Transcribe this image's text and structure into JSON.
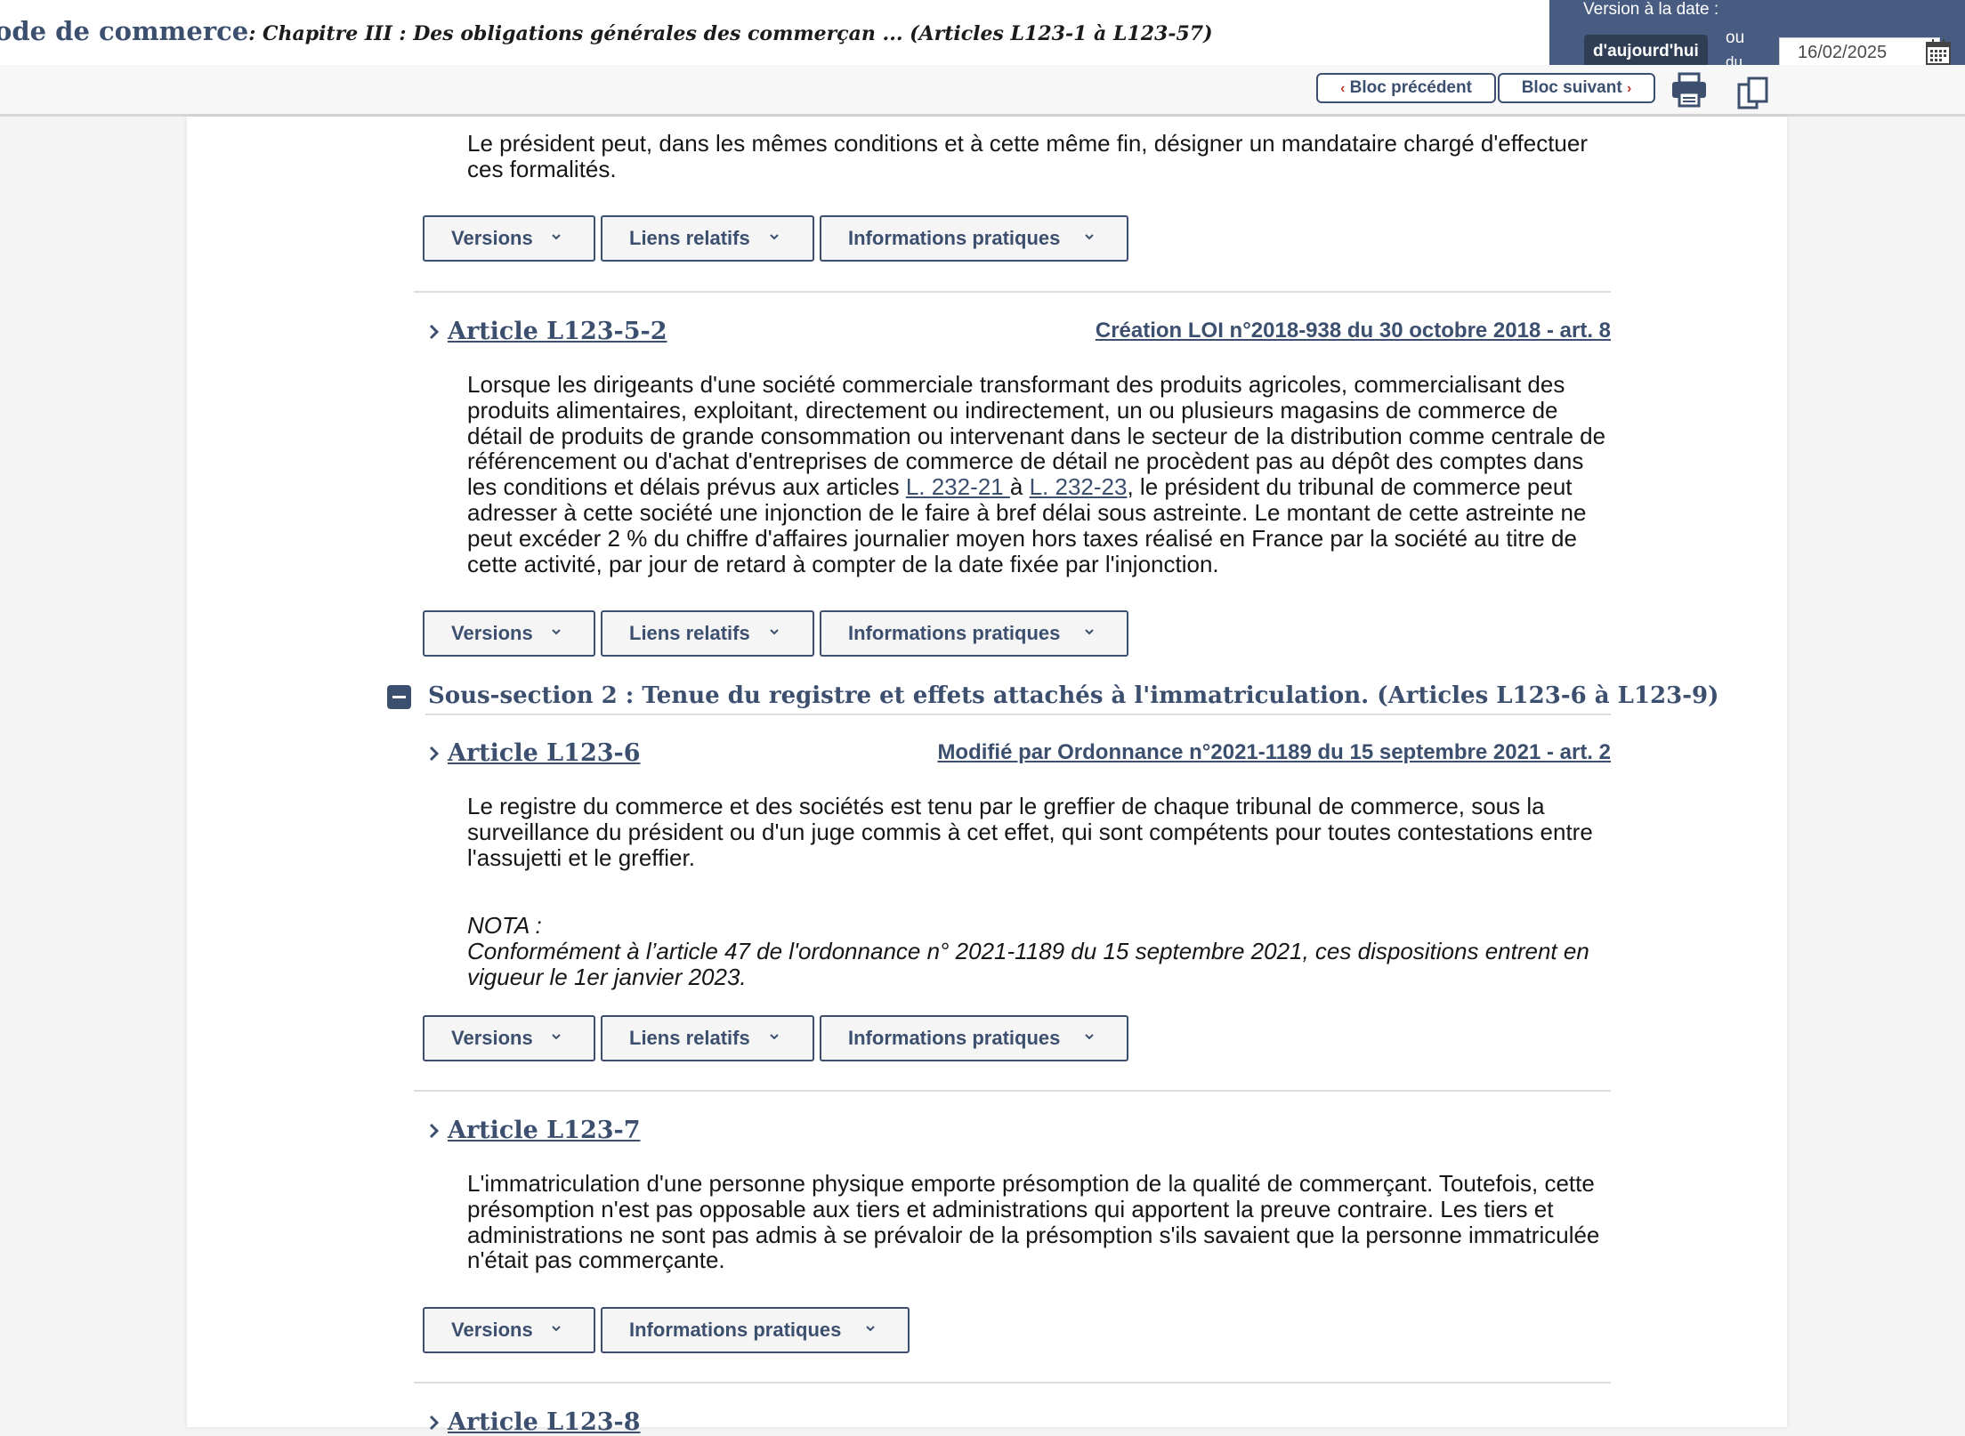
{
  "header": {
    "code_name": "ode de commerce",
    "chapter_title": ": Chapitre III : Des obligations générales des commerçan ... (Articles L123-1 à L123-57)"
  },
  "version": {
    "label": "Version à la date :",
    "today_label": "d'aujourd'hui",
    "or_label": "ou",
    "du_label": "du",
    "date_value": "16/02/2025"
  },
  "toolbar": {
    "prev_label": "Bloc précédent",
    "next_label": "Bloc suivant",
    "prev_chevron": "‹",
    "next_chevron": "›"
  },
  "buttons": {
    "versions": "Versions",
    "liens": "Liens relatifs",
    "infos": "Informations pratiques"
  },
  "prev_article": {
    "text": "Le président peut, dans les mêmes conditions et à cette même fin, désigner un mandataire chargé d'effectuer ces formalités."
  },
  "article_5_2": {
    "title": "Article L123-5-2",
    "meta": "Création LOI n°2018-938 du 30 octobre 2018 - art. 8",
    "text_before": "Lorsque les dirigeants d'une société commerciale transformant des produits agricoles, commercialisant des produits alimentaires, exploitant, directement ou indirectement, un ou plusieurs magasins de commerce de détail de produits de grande consommation ou intervenant dans le secteur de la distribution comme centrale de référencement ou d'achat d'entreprises de commerce de détail ne procèdent pas au dépôt des comptes dans les conditions et délais prévus aux articles ",
    "link1": "L. 232-21 ",
    "text_mid": "à ",
    "link2": "L. 232-23",
    "text_after": ", le président du tribunal de commerce peut adresser à cette société une injonction de le faire à bref délai sous astreinte. Le montant de cette astreinte ne peut excéder 2 % du chiffre d'affaires journalier moyen hors taxes réalisé en France par la société au titre de cette activité, par jour de retard à compter de la date fixée par l'injonction."
  },
  "subsection": {
    "title": "Sous-section 2 : Tenue du registre et effets attachés à l'immatriculation. (Articles L123-6 à L123-9)"
  },
  "article_6": {
    "title": "Article L123-6",
    "meta": "Modifié par Ordonnance n°2021-1189 du 15 septembre 2021 - art. 2",
    "text": "Le registre du commerce et des sociétés est tenu par le greffier de chaque tribunal de commerce, sous la surveillance du président ou d'un juge commis à cet effet, qui sont compétents pour toutes contestations entre l'assujetti et le greffier.",
    "nota_label": "NOTA :",
    "nota_text": "Conformément à l’article 47 de l'ordonnance n° 2021-1189 du 15 septembre 2021, ces dispositions entrent en vigueur le 1er janvier 2023."
  },
  "article_7": {
    "title": "Article L123-7",
    "text": "L'immatriculation d'une personne physique emporte présomption de la qualité de commerçant. Toutefois, cette présomption n'est pas opposable aux tiers et administrations qui apportent la preuve contraire. Les tiers et administrations ne sont pas admis à se prévaloir de la présomption s'ils savaient que la personne immatriculée n'était pas commerçante."
  },
  "article_8": {
    "title": "Article L123-8"
  },
  "colors": {
    "brand_blue": "#3c4f6e",
    "panel_blue": "#475c80",
    "link_red": "#c0392b"
  },
  "icons": {
    "print": "printer-icon",
    "copy": "copy-icon",
    "calendar": "calendar-icon"
  }
}
